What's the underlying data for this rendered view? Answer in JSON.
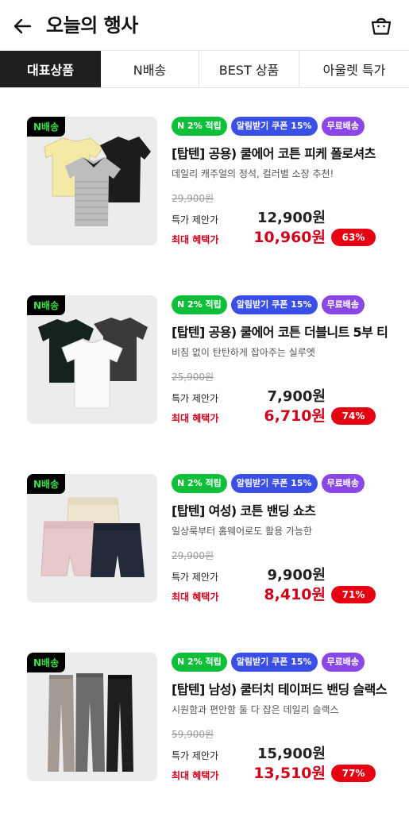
{
  "header": {
    "title": "오늘의 행사"
  },
  "tabs": [
    {
      "label": "대표상품",
      "active": true
    },
    {
      "label": "N배송",
      "active": false
    },
    {
      "label": "BEST 상품",
      "active": false
    },
    {
      "label": "아울렛 특가",
      "active": false
    }
  ],
  "colors": {
    "accent_red": "#e60012",
    "badge_green": "#0fbf3a",
    "badge_blue": "#3a4fe6",
    "badge_purple": "#8b47e6",
    "nbadge_text": "#3be24a"
  },
  "products": [
    {
      "n_badge": "N배송",
      "badges": [
        "N 2% 적립",
        "알림받기 쿠폰 15%",
        "무료배송"
      ],
      "name": "[탑텐] 공용) 쿨에어 코튼 피케 폴로셔츠",
      "desc": "데일리 캐주얼의 정석, 컬러별 소장 추천!",
      "original_price": "29,900원",
      "label_special": "특가 제안가",
      "special_price": "12,900원",
      "label_max": "최대 혜택가",
      "max_price": "10,960원",
      "discount": "63%"
    },
    {
      "n_badge": "N배송",
      "badges": [
        "N 2% 적립",
        "알림받기 쿠폰 15%",
        "무료배송"
      ],
      "name": "[탑텐] 공용) 쿨에어 코튼 더블니트 5부 티",
      "desc": "비침 없이 탄탄하게 잡아주는 실루엣",
      "original_price": "25,900원",
      "label_special": "특가 제안가",
      "special_price": "7,900원",
      "label_max": "최대 혜택가",
      "max_price": "6,710원",
      "discount": "74%"
    },
    {
      "n_badge": "N배송",
      "badges": [
        "N 2% 적립",
        "알림받기 쿠폰 15%",
        "무료배송"
      ],
      "name": "[탑텐] 여성) 코튼 밴딩 쇼츠",
      "desc": "일상룩부터 홈웨어로도 활용 가능한",
      "original_price": "29,900원",
      "label_special": "특가 제안가",
      "special_price": "9,900원",
      "label_max": "최대 혜택가",
      "max_price": "8,410원",
      "discount": "71%"
    },
    {
      "n_badge": "N배송",
      "badges": [
        "N 2% 적립",
        "알림받기 쿠폰 15%",
        "무료배송"
      ],
      "name": "[탑텐] 남성) 쿨터치 테이퍼드 밴딩 슬랙스",
      "desc": "시원함과 편안함 둘 다 잡은 데일리 슬랙스",
      "original_price": "59,900원",
      "label_special": "특가 제안가",
      "special_price": "15,900원",
      "label_max": "최대 혜택가",
      "max_price": "13,510원",
      "discount": "77%"
    }
  ],
  "icons": {
    "back": "arrow-left-icon",
    "cart": "shopping-bag-icon"
  }
}
